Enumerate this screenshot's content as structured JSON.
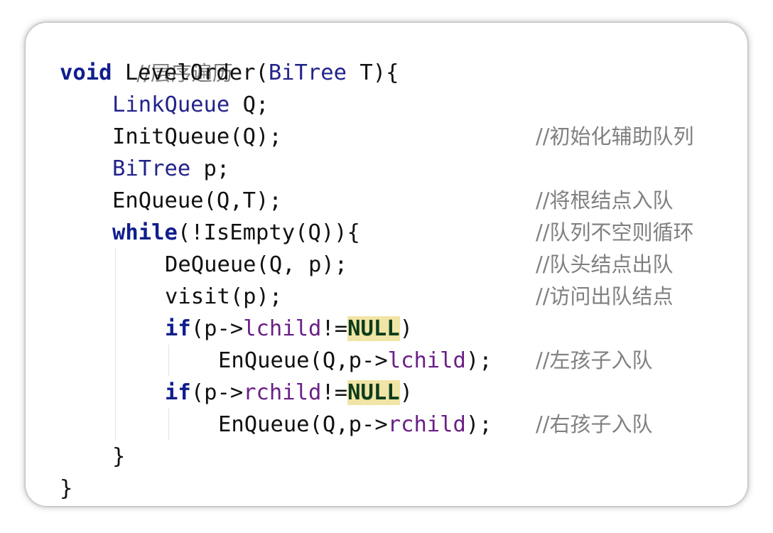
{
  "code": {
    "header_comment": "//层序遍历",
    "signature": {
      "kw": "void",
      "name": " LevelOrder(",
      "type": "BiTree",
      "rest": " T){"
    },
    "l2": {
      "type": "LinkQueue",
      "rest": " Q;"
    },
    "l3": {
      "text": "InitQueue(Q);"
    },
    "l4": {
      "type": "BiTree",
      "rest": " p;"
    },
    "l5": {
      "text": "EnQueue(Q,T);"
    },
    "l6": {
      "kw": "while",
      "rest": "(!IsEmpty(Q)){"
    },
    "l7": {
      "text": "DeQueue(Q, p);"
    },
    "l8": {
      "text": "visit(p);"
    },
    "l9": {
      "kw": "if",
      "pre": "(p->",
      "field": "lchild",
      "mid": "!=",
      "null": "NULL",
      "post": ")"
    },
    "l10": {
      "pre": "EnQueue(Q,p->",
      "field": "lchild",
      "post": ");"
    },
    "l11": {
      "kw": "if",
      "pre": "(p->",
      "field": "rchild",
      "mid": "!=",
      "null": "NULL",
      "post": ")"
    },
    "l12": {
      "pre": "EnQueue(Q,p->",
      "field": "rchild",
      "post": ");"
    },
    "l13": {
      "text": "}"
    },
    "l14": {
      "text": "}"
    }
  },
  "comments": {
    "init": "//初始化辅助队列",
    "enqueue_root": "//将根结点入队",
    "loop": "//队列不空则循环",
    "dequeue": "//队头结点出队",
    "visit": "//访问出队结点",
    "left": "//左孩子入队",
    "right": "//右孩子入队"
  }
}
